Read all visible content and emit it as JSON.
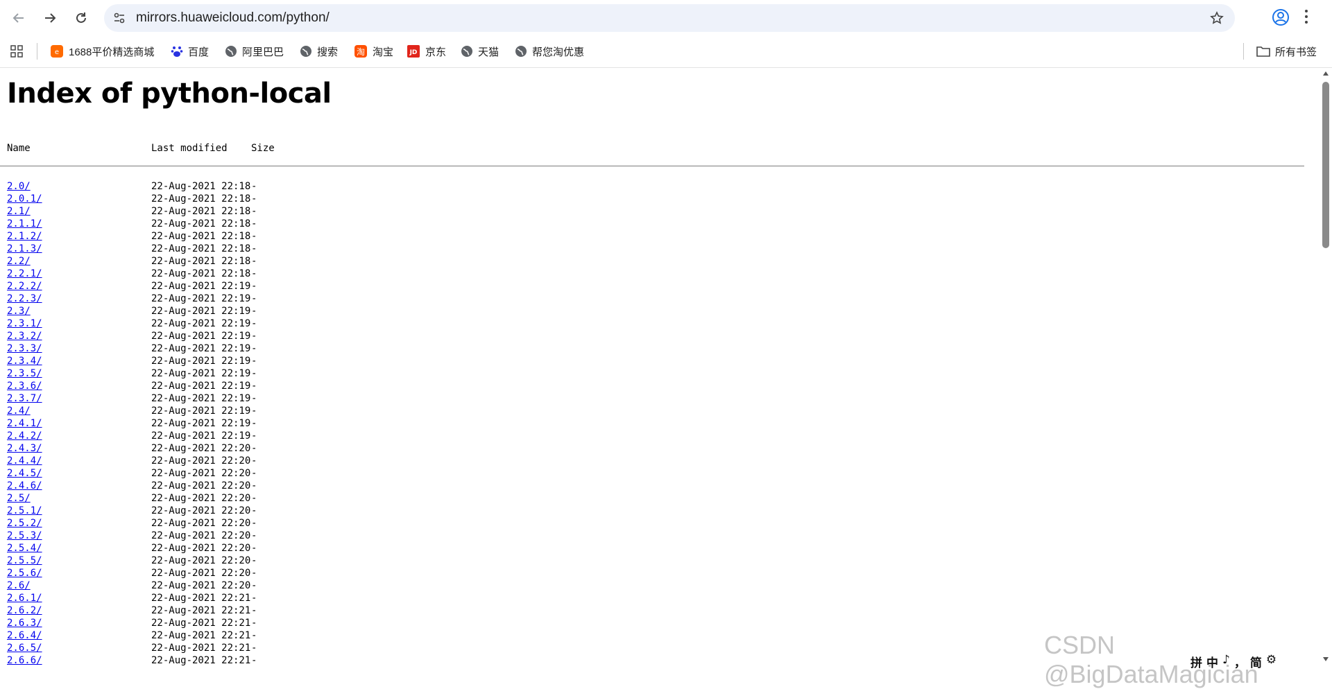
{
  "browser": {
    "url": "mirrors.huaweicloud.com/python/"
  },
  "bookmarks": {
    "items": [
      {
        "label": "1688平价精选商城",
        "icon": "1688-icon"
      },
      {
        "label": "百度",
        "icon": "baidu-icon"
      },
      {
        "label": "阿里巴巴",
        "icon": "globe-icon"
      },
      {
        "label": "搜索",
        "icon": "globe-icon"
      },
      {
        "label": "淘宝",
        "icon": "taobao-icon"
      },
      {
        "label": "京东",
        "icon": "jd-icon"
      },
      {
        "label": "天猫",
        "icon": "globe-icon"
      },
      {
        "label": "帮您淘优惠",
        "icon": "globe-icon"
      }
    ],
    "all_bookmarks_label": "所有书签"
  },
  "page": {
    "title": "Index of python-local",
    "headers": {
      "name": "Name",
      "modified": "Last modified",
      "size": "Size"
    },
    "entries": [
      {
        "name": "2.0/",
        "modified": "22-Aug-2021 22:18",
        "size": "-"
      },
      {
        "name": "2.0.1/",
        "modified": "22-Aug-2021 22:18",
        "size": "-"
      },
      {
        "name": "2.1/",
        "modified": "22-Aug-2021 22:18",
        "size": "-"
      },
      {
        "name": "2.1.1/",
        "modified": "22-Aug-2021 22:18",
        "size": "-"
      },
      {
        "name": "2.1.2/",
        "modified": "22-Aug-2021 22:18",
        "size": "-"
      },
      {
        "name": "2.1.3/",
        "modified": "22-Aug-2021 22:18",
        "size": "-"
      },
      {
        "name": "2.2/",
        "modified": "22-Aug-2021 22:18",
        "size": "-"
      },
      {
        "name": "2.2.1/",
        "modified": "22-Aug-2021 22:18",
        "size": "-"
      },
      {
        "name": "2.2.2/",
        "modified": "22-Aug-2021 22:19",
        "size": "-"
      },
      {
        "name": "2.2.3/",
        "modified": "22-Aug-2021 22:19",
        "size": "-"
      },
      {
        "name": "2.3/",
        "modified": "22-Aug-2021 22:19",
        "size": "-"
      },
      {
        "name": "2.3.1/",
        "modified": "22-Aug-2021 22:19",
        "size": "-"
      },
      {
        "name": "2.3.2/",
        "modified": "22-Aug-2021 22:19",
        "size": "-"
      },
      {
        "name": "2.3.3/",
        "modified": "22-Aug-2021 22:19",
        "size": "-"
      },
      {
        "name": "2.3.4/",
        "modified": "22-Aug-2021 22:19",
        "size": "-"
      },
      {
        "name": "2.3.5/",
        "modified": "22-Aug-2021 22:19",
        "size": "-"
      },
      {
        "name": "2.3.6/",
        "modified": "22-Aug-2021 22:19",
        "size": "-"
      },
      {
        "name": "2.3.7/",
        "modified": "22-Aug-2021 22:19",
        "size": "-"
      },
      {
        "name": "2.4/",
        "modified": "22-Aug-2021 22:19",
        "size": "-"
      },
      {
        "name": "2.4.1/",
        "modified": "22-Aug-2021 22:19",
        "size": "-"
      },
      {
        "name": "2.4.2/",
        "modified": "22-Aug-2021 22:19",
        "size": "-"
      },
      {
        "name": "2.4.3/",
        "modified": "22-Aug-2021 22:20",
        "size": "-"
      },
      {
        "name": "2.4.4/",
        "modified": "22-Aug-2021 22:20",
        "size": "-"
      },
      {
        "name": "2.4.5/",
        "modified": "22-Aug-2021 22:20",
        "size": "-"
      },
      {
        "name": "2.4.6/",
        "modified": "22-Aug-2021 22:20",
        "size": "-"
      },
      {
        "name": "2.5/",
        "modified": "22-Aug-2021 22:20",
        "size": "-"
      },
      {
        "name": "2.5.1/",
        "modified": "22-Aug-2021 22:20",
        "size": "-"
      },
      {
        "name": "2.5.2/",
        "modified": "22-Aug-2021 22:20",
        "size": "-"
      },
      {
        "name": "2.5.3/",
        "modified": "22-Aug-2021 22:20",
        "size": "-"
      },
      {
        "name": "2.5.4/",
        "modified": "22-Aug-2021 22:20",
        "size": "-"
      },
      {
        "name": "2.5.5/",
        "modified": "22-Aug-2021 22:20",
        "size": "-"
      },
      {
        "name": "2.5.6/",
        "modified": "22-Aug-2021 22:20",
        "size": "-"
      },
      {
        "name": "2.6/",
        "modified": "22-Aug-2021 22:20",
        "size": "-"
      },
      {
        "name": "2.6.1/",
        "modified": "22-Aug-2021 22:21",
        "size": "-"
      },
      {
        "name": "2.6.2/",
        "modified": "22-Aug-2021 22:21",
        "size": "-"
      },
      {
        "name": "2.6.3/",
        "modified": "22-Aug-2021 22:21",
        "size": "-"
      },
      {
        "name": "2.6.4/",
        "modified": "22-Aug-2021 22:21",
        "size": "-"
      },
      {
        "name": "2.6.5/",
        "modified": "22-Aug-2021 22:21",
        "size": "-"
      },
      {
        "name": "2.6.6/",
        "modified": "22-Aug-2021 22:21",
        "size": "-"
      }
    ]
  },
  "watermark": "CSDN @BigDataMagician",
  "ime": [
    "拼",
    "中",
    "♪",
    "，",
    "简",
    "⚙"
  ],
  "colors": {
    "link": "#0000ee",
    "omnibox_bg": "#eef2fa"
  }
}
